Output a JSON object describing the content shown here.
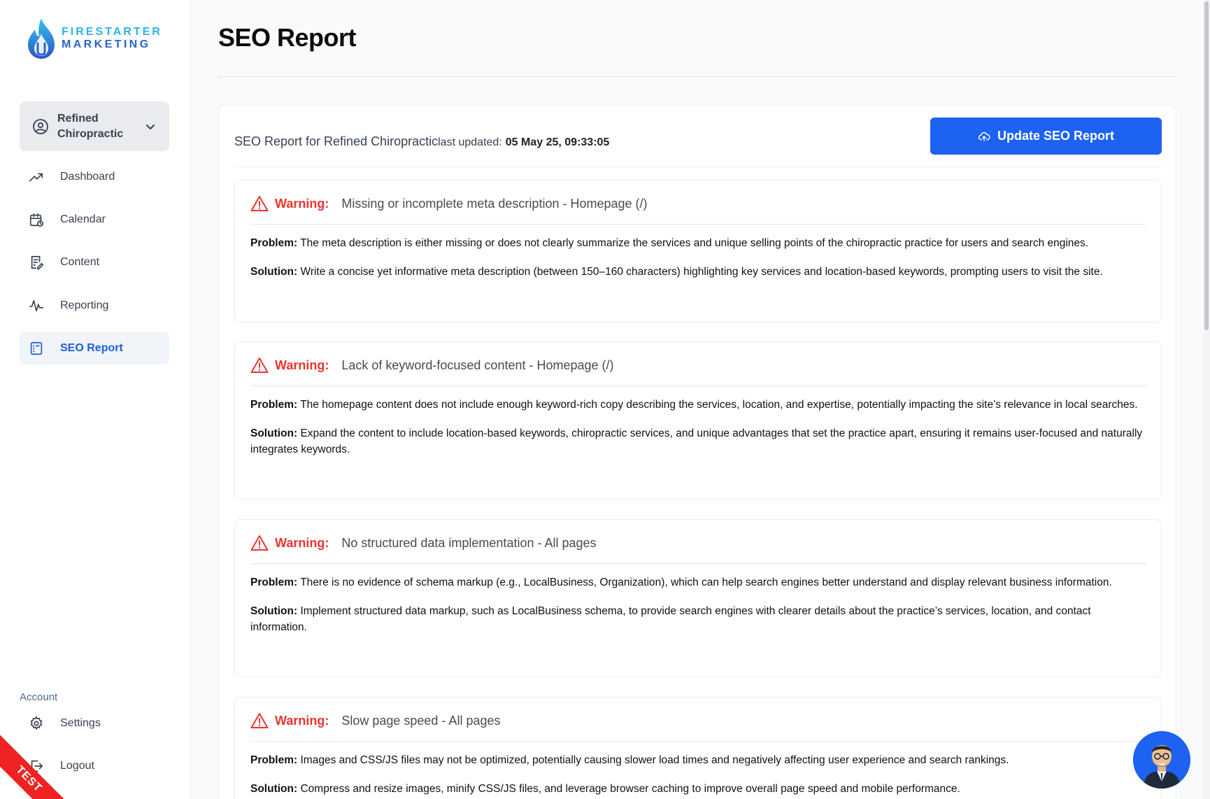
{
  "brand": {
    "line1": "FIRESTARTER",
    "line2": "MARKETING"
  },
  "client_selector": {
    "name": "Refined Chiropractic"
  },
  "nav": {
    "items": [
      {
        "label": "Dashboard",
        "icon": "trending-up-icon"
      },
      {
        "label": "Calendar",
        "icon": "calendar-icon"
      },
      {
        "label": "Content",
        "icon": "document-edit-icon"
      },
      {
        "label": "Reporting",
        "icon": "activity-icon"
      },
      {
        "label": "SEO Report",
        "icon": "seo-report-icon",
        "active": true
      }
    ],
    "account_label": "Account",
    "settings": "Settings",
    "logout": "Logout"
  },
  "ribbon": "TEST",
  "page": {
    "title": "SEO Report"
  },
  "report": {
    "heading": "SEO Report for Refined Chiropractic",
    "last_updated_label": "last updated:",
    "last_updated_value": "05 May 25, 09:33:05",
    "update_button": "Update SEO Report"
  },
  "issues": [
    {
      "level": "Warning:",
      "title": "Missing or incomplete meta description - Homepage (/)",
      "problem_label": "Problem:",
      "problem": "The meta description is either missing or does not clearly summarize the services and unique selling points of the chiropractic practice for users and search engines.",
      "solution_label": "Solution:",
      "solution": "Write a concise yet informative meta description (between 150–160 characters) highlighting key services and location-based keywords, prompting users to visit the site."
    },
    {
      "level": "Warning:",
      "title": "Lack of keyword-focused content - Homepage (/)",
      "problem_label": "Problem:",
      "problem": "The homepage content does not include enough keyword-rich copy describing the services, location, and expertise, potentially impacting the site’s relevance in local searches.",
      "solution_label": "Solution:",
      "solution": "Expand the content to include location-based keywords, chiropractic services, and unique advantages that set the practice apart, ensuring it remains user-focused and naturally integrates keywords."
    },
    {
      "level": "Warning:",
      "title": "No structured data implementation - All pages",
      "problem_label": "Problem:",
      "problem": "There is no evidence of schema markup (e.g., LocalBusiness, Organization), which can help search engines better understand and display relevant business information.",
      "solution_label": "Solution:",
      "solution": "Implement structured data markup, such as LocalBusiness schema, to provide search engines with clearer details about the practice’s services, location, and contact information."
    },
    {
      "level": "Warning:",
      "title": "Slow page speed - All pages",
      "problem_label": "Problem:",
      "problem": "Images and CSS/JS files may not be optimized, potentially causing slower load times and negatively affecting user experience and search rankings.",
      "solution_label": "Solution:",
      "solution": "Compress and resize images, minify CSS/JS files, and leverage browser caching to improve overall page speed and mobile performance."
    }
  ],
  "colors": {
    "accent": "#1d62f0",
    "warning": "#e8352e",
    "active_nav": "#1d5ed8"
  }
}
